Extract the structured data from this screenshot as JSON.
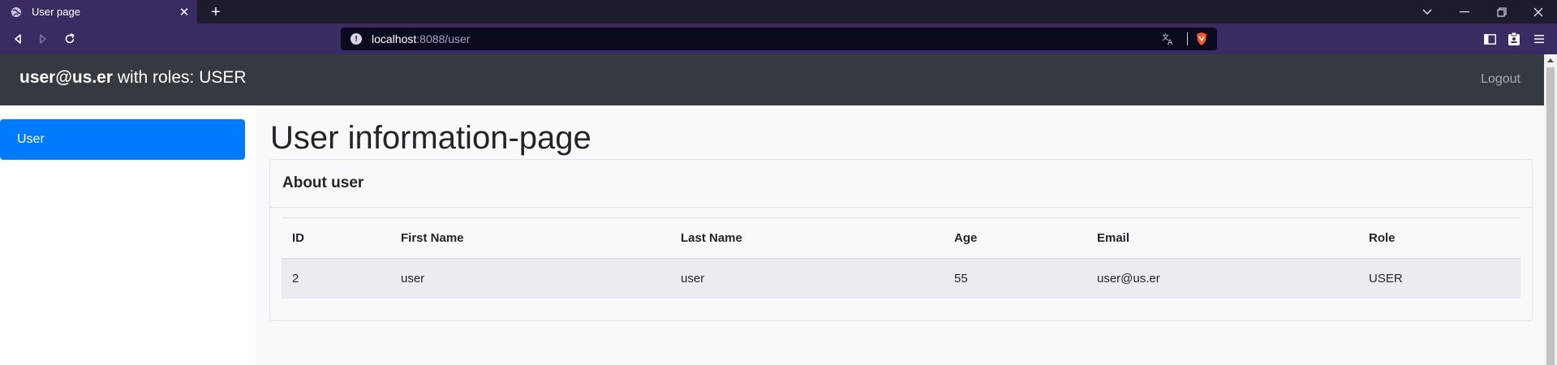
{
  "browser": {
    "tab_title": "User page",
    "url_host": "localhost",
    "url_rest": ":8088/user",
    "icons": {
      "favicon": "globe-icon",
      "tab_close": "close-icon",
      "new_tab": "plus-icon",
      "back": "back-arrow-icon",
      "forward": "forward-arrow-icon",
      "reload": "reload-icon",
      "site_info": "info-icon",
      "translate": "translate-icon",
      "shields": "brave-shield-icon",
      "sidebar": "sidebar-icon",
      "wallet": "wallet-icon",
      "menu": "menu-icon",
      "tab_search": "chevron-down-icon",
      "minimize": "minimize-icon",
      "restore": "restore-icon",
      "close_window": "close-icon"
    },
    "colors": {
      "chrome": "#3b2b63",
      "tabstrip": "#1e1b2e",
      "urlbar": "#0c0a1e"
    }
  },
  "navbar": {
    "user_email": "user@us.er",
    "roles_text": " with roles: USER",
    "logout_label": "Logout",
    "background": "#343a40"
  },
  "sidebar": {
    "items": [
      {
        "label": "User",
        "active": true
      }
    ],
    "accent": "#007bff"
  },
  "main": {
    "title": "User information-page",
    "card": {
      "header": "About user",
      "table": {
        "columns": [
          "ID",
          "First Name",
          "Last Name",
          "Age",
          "Email",
          "Role"
        ],
        "rows": [
          [
            "2",
            "user",
            "user",
            "55",
            "user@us.er",
            "USER"
          ]
        ]
      }
    }
  }
}
